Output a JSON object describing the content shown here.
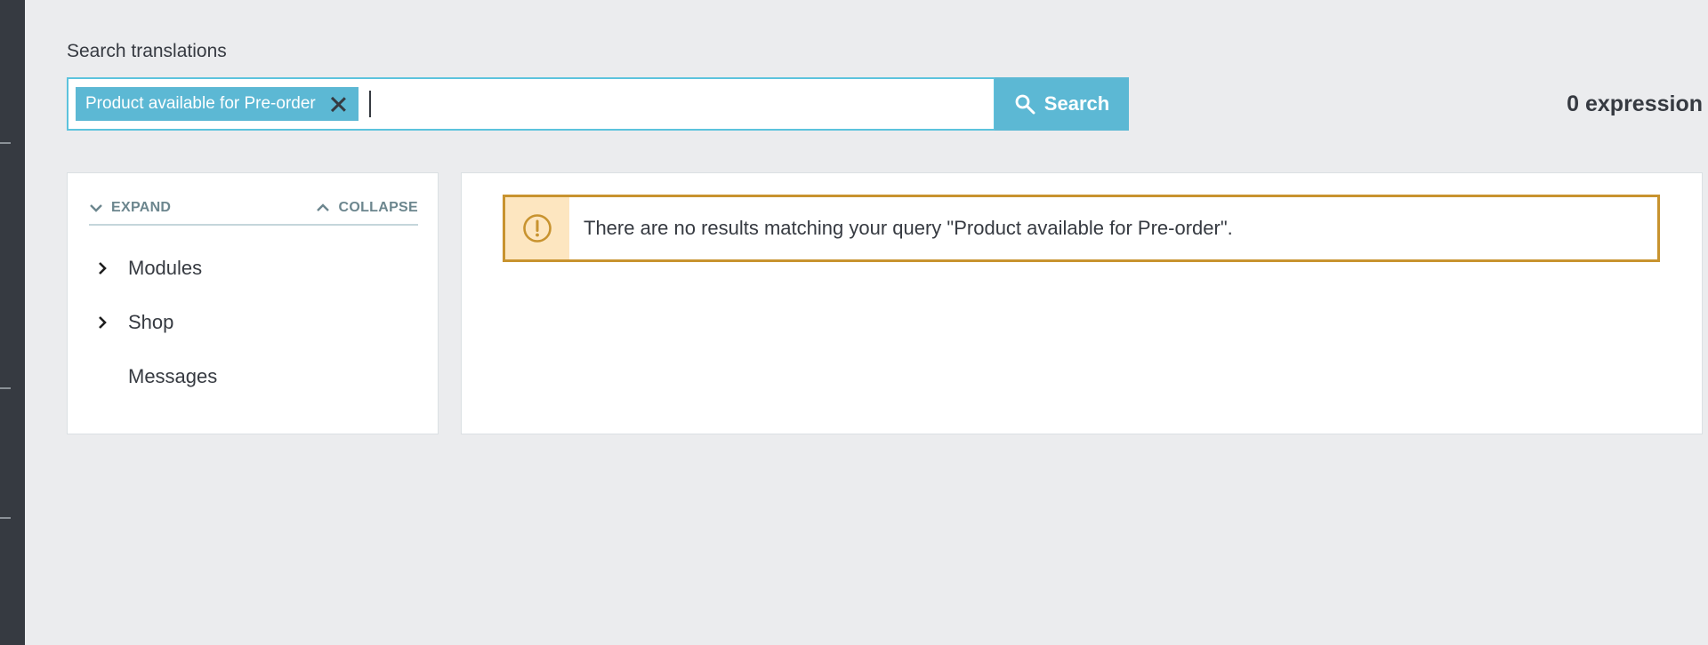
{
  "search": {
    "label": "Search translations",
    "tags": [
      "Product available for Pre-order"
    ],
    "input_value": "",
    "button_label": "Search"
  },
  "results_count": "0 expression",
  "tree": {
    "expand_label": "EXPAND",
    "collapse_label": "COLLAPSE",
    "items": [
      {
        "label": "Modules",
        "has_children": true
      },
      {
        "label": "Shop",
        "has_children": true
      },
      {
        "label": "Messages",
        "has_children": false
      }
    ]
  },
  "alert": {
    "message": "There are no results matching your query \"Product available for Pre-order\".",
    "type": "warning"
  },
  "colors": {
    "accent": "#5cb8d4",
    "warning_border": "#c8932f",
    "warning_bg": "#fde6c0",
    "sidebar": "#363a41",
    "page_bg": "#ebecee"
  },
  "icons": {
    "search_button": "search-icon",
    "tag_remove": "close-icon",
    "expand": "chevron-down-icon",
    "collapse": "chevron-up-icon",
    "tree_item": "chevron-right-icon",
    "alert": "warning-icon"
  }
}
